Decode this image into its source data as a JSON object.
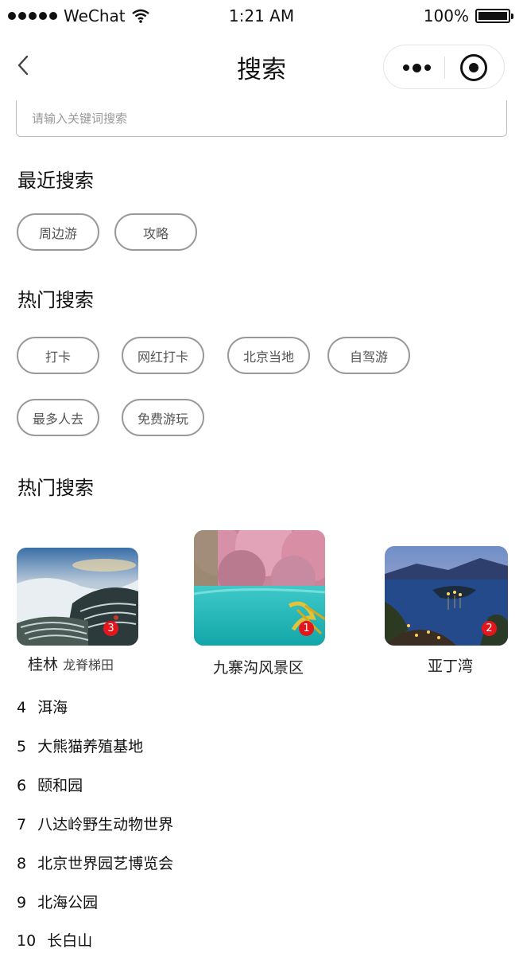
{
  "status_bar": {
    "carrier": "WeChat",
    "time": "1:21 AM",
    "battery": "100%"
  },
  "nav": {
    "title": "搜索"
  },
  "search": {
    "placeholder": "请输入关键词搜索"
  },
  "recent": {
    "title": "最近搜索",
    "tags": [
      "周边游",
      "攻略"
    ]
  },
  "hot": {
    "title": "热门搜索",
    "tags": [
      "打卡",
      "网红打卡",
      "北京当地",
      "自驾游",
      "最多人去",
      "免费游玩"
    ]
  },
  "ranking": {
    "title": "热门搜索",
    "top": [
      {
        "rank": "3",
        "name": "桂林",
        "sub": "龙脊梯田"
      },
      {
        "rank": "1",
        "name": "九寨沟风景区",
        "sub": ""
      },
      {
        "rank": "2",
        "name": "亚丁湾",
        "sub": ""
      }
    ],
    "list": [
      {
        "rank": "4",
        "name": "洱海"
      },
      {
        "rank": "5",
        "name": "大熊猫养殖基地"
      },
      {
        "rank": "6",
        "name": "颐和园"
      },
      {
        "rank": "7",
        "name": "八达岭野生动物世界"
      },
      {
        "rank": "8",
        "name": "北京世界园艺博览会"
      },
      {
        "rank": "9",
        "name": "北海公园"
      },
      {
        "rank": "10",
        "name": "长白山"
      }
    ]
  }
}
